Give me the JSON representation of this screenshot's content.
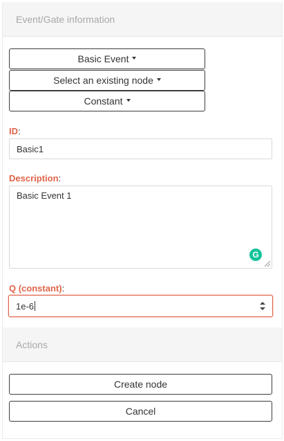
{
  "panel": {
    "header_title": "Event/Gate information"
  },
  "dropdowns": [
    {
      "label": "Basic Event"
    },
    {
      "label": "Select an existing node"
    },
    {
      "label": "Constant"
    }
  ],
  "fields": {
    "id": {
      "label": "ID",
      "suffix": ":",
      "value": "Basic1"
    },
    "description": {
      "label": "Description",
      "suffix": ":",
      "value": "Basic Event 1"
    },
    "q": {
      "label": "Q (constant)",
      "suffix": ":",
      "value": "1e-6"
    }
  },
  "grammarly_icon": "G",
  "actions": {
    "header_title": "Actions",
    "create_label": "Create node",
    "cancel_label": "Cancel"
  },
  "colors": {
    "accent": "#e0644a",
    "grammarly": "#15c39a"
  }
}
